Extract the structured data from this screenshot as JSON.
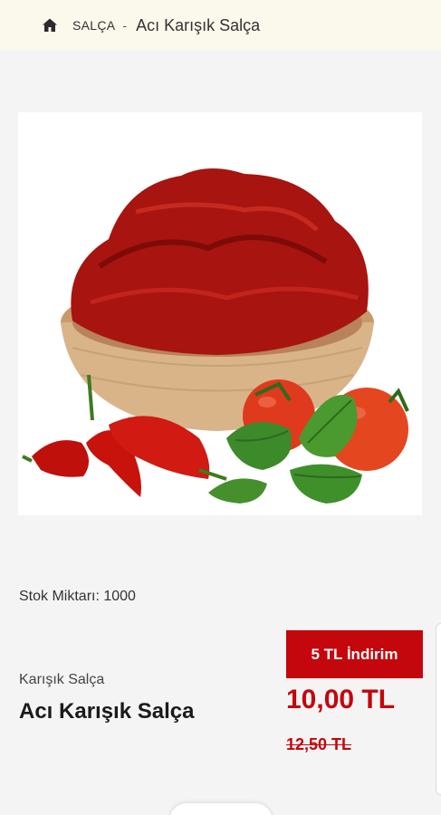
{
  "breadcrumb": {
    "home_icon": "home-icon",
    "category": "SALÇA",
    "separator": "-",
    "current": "Acı Karışık Salça"
  },
  "product": {
    "image_alt": "Acı Karışık Salça",
    "stock_text": "Stok Miktarı: 1000",
    "category": "Karışık Salça",
    "name": "Acı Karışık Salça",
    "discount_badge": "5 TL İndirim",
    "price": "10,00 TL",
    "old_price": "12,50 TL"
  },
  "colors": {
    "accent": "#c4060d",
    "breadcrumb_bg": "#fbf8ec",
    "page_bg": "#f4f4f4"
  }
}
